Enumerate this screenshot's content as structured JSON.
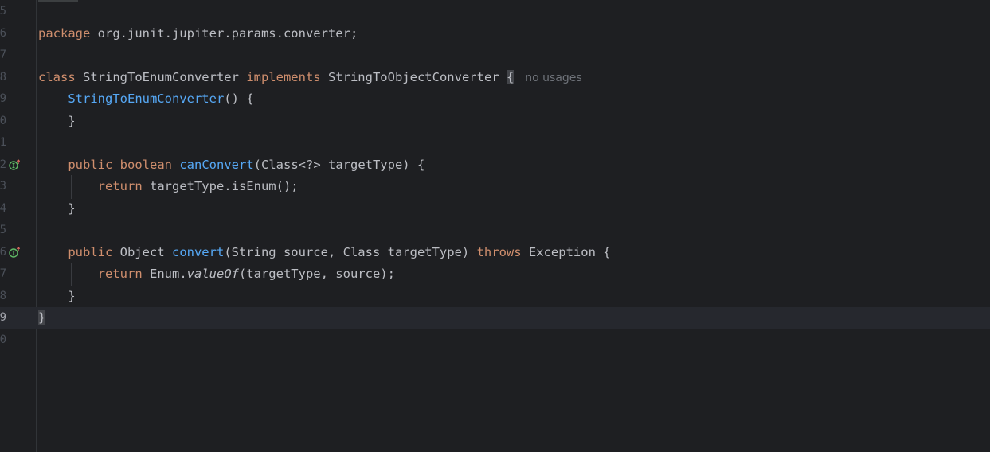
{
  "editor": {
    "lines": [
      {
        "n": "5",
        "tokens": []
      },
      {
        "n": "6",
        "tokens": [
          {
            "t": "package",
            "c": "kw"
          },
          {
            "t": " org.junit.jupiter.params.converter;",
            "c": ""
          }
        ]
      },
      {
        "n": "7",
        "tokens": []
      },
      {
        "n": "8",
        "tokens": [
          {
            "t": "class",
            "c": "kw"
          },
          {
            "t": " StringToEnumConverter ",
            "c": ""
          },
          {
            "t": "implements",
            "c": "kw"
          },
          {
            "t": " StringToObjectConverter ",
            "c": ""
          },
          {
            "t": "{",
            "c": "brace-hl"
          }
        ],
        "hint": "no usages"
      },
      {
        "n": "9",
        "tokens": [
          {
            "t": "    ",
            "c": ""
          },
          {
            "t": "StringToEnumConverter",
            "c": "fn"
          },
          {
            "t": "() {",
            "c": ""
          }
        ]
      },
      {
        "n": "0",
        "tokens": [
          {
            "t": "    }",
            "c": ""
          }
        ]
      },
      {
        "n": "1",
        "tokens": []
      },
      {
        "n": "2",
        "icon": true,
        "tokens": [
          {
            "t": "    ",
            "c": ""
          },
          {
            "t": "public",
            "c": "kw"
          },
          {
            "t": " ",
            "c": ""
          },
          {
            "t": "boolean",
            "c": "kw"
          },
          {
            "t": " ",
            "c": ""
          },
          {
            "t": "canConvert",
            "c": "fn"
          },
          {
            "t": "(Class<?> targetType) {",
            "c": ""
          }
        ]
      },
      {
        "n": "3",
        "tokens": [
          {
            "t": "        ",
            "c": ""
          },
          {
            "t": "return",
            "c": "kw"
          },
          {
            "t": " targetType.isEnum();",
            "c": ""
          }
        ]
      },
      {
        "n": "4",
        "tokens": [
          {
            "t": "    }",
            "c": ""
          }
        ]
      },
      {
        "n": "5",
        "tokens": []
      },
      {
        "n": "6",
        "icon": true,
        "tokens": [
          {
            "t": "    ",
            "c": ""
          },
          {
            "t": "public",
            "c": "kw"
          },
          {
            "t": " Object ",
            "c": ""
          },
          {
            "t": "convert",
            "c": "fn"
          },
          {
            "t": "(String source, Class targetType) ",
            "c": ""
          },
          {
            "t": "throws",
            "c": "kw"
          },
          {
            "t": " Exception {",
            "c": ""
          }
        ]
      },
      {
        "n": "7",
        "tokens": [
          {
            "t": "        ",
            "c": ""
          },
          {
            "t": "return",
            "c": "kw"
          },
          {
            "t": " Enum.",
            "c": ""
          },
          {
            "t": "valueOf",
            "c": "it"
          },
          {
            "t": "(targetType, source);",
            "c": ""
          }
        ]
      },
      {
        "n": "8",
        "tokens": [
          {
            "t": "    }",
            "c": ""
          }
        ]
      },
      {
        "n": "9",
        "current": true,
        "tokens": [
          {
            "t": "}",
            "c": "brace-hl"
          }
        ]
      },
      {
        "n": "0",
        "tokens": []
      }
    ]
  },
  "colors": {
    "background": "#1e1f22",
    "keyword": "#cf8e6d",
    "function": "#56a8f5",
    "text": "#bcbec4",
    "hint": "#6f737a",
    "implements_icon": "#5fb865"
  },
  "icons": {
    "gutter": "implements-method-icon"
  }
}
